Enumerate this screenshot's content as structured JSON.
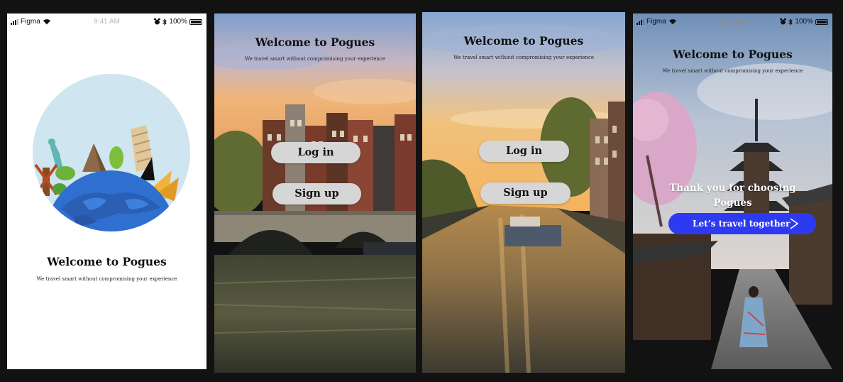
{
  "status_bar": {
    "carrier": "Figma",
    "time": "9:41 AM",
    "battery_percent": "100%"
  },
  "screens": [
    {
      "id": "splash",
      "title": "Welcome to Pogues",
      "subtitle": "We travel smart without compromising your experience"
    },
    {
      "id": "auth-bridge",
      "title": "Welcome to Pogues",
      "subtitle": "We travel smart without compromising your experience",
      "login_label": "Log in",
      "signup_label": "Sign up"
    },
    {
      "id": "auth-canal",
      "title": "Welcome to Pogues",
      "subtitle": "We travel smart without compromising your experience",
      "login_label": "Log in",
      "signup_label": "Sign up"
    },
    {
      "id": "thank-you",
      "title": "Welcome to Pogues",
      "subtitle": "We travel smart without compromising your experience",
      "thanks_line1": "Thank you for choosing",
      "thanks_line2": "Pogues",
      "cta_label": "Let’s travel together"
    }
  ],
  "colors": {
    "canvas_bg": "#121212",
    "pill_bg": "#d6d6d6",
    "cta_bg": "#2d3af2",
    "globe_sky": "#cfe6f0",
    "globe_earth": "#2f6fd0"
  },
  "icons": [
    "signal-icon",
    "wifi-icon",
    "alarm-icon",
    "bluetooth-icon",
    "battery-icon",
    "arrow-right-icon"
  ]
}
